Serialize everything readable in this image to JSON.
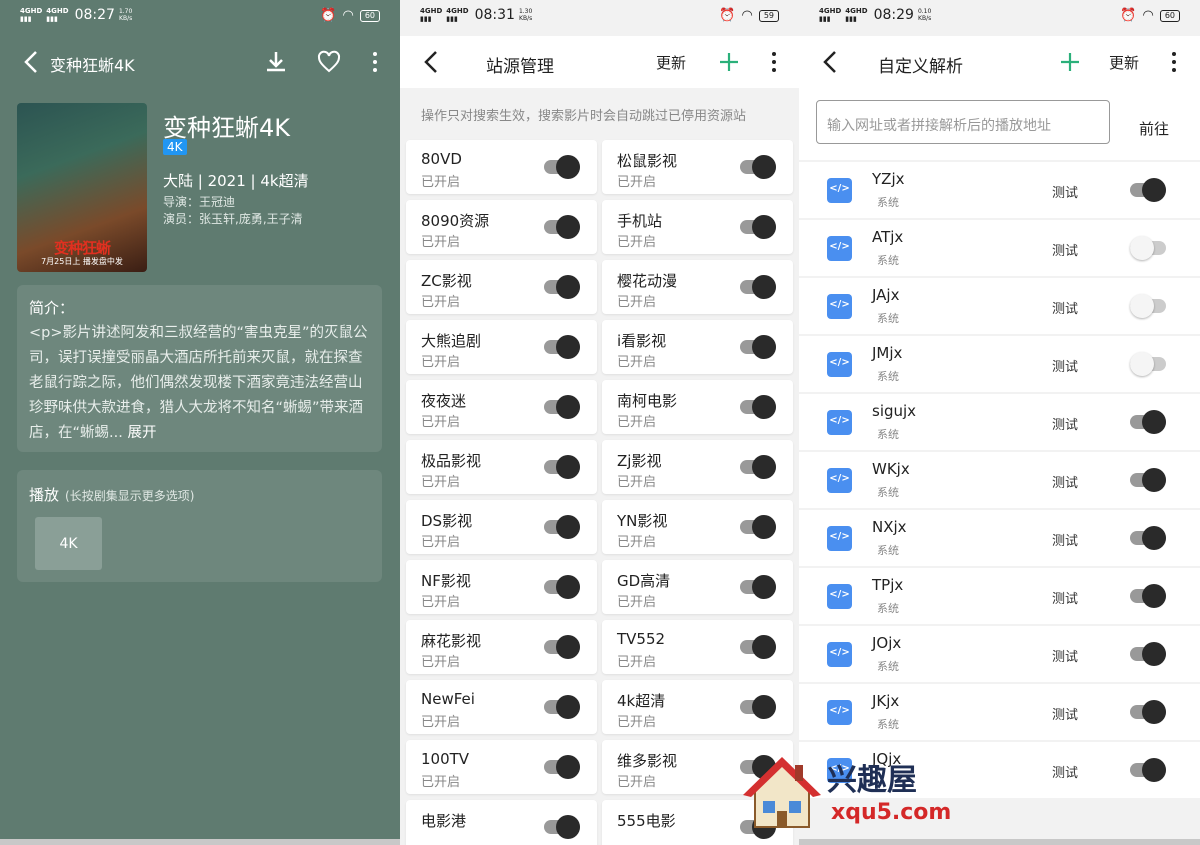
{
  "panel1": {
    "status": {
      "net1": "4GHD",
      "net2": "4GHD",
      "time": "08:27",
      "speed_value": "1.70",
      "speed_unit": "KB/s",
      "battery": "60"
    },
    "header_title": "变种狂蜥4K",
    "poster_title": "变种狂蜥",
    "poster_date": "7月25日上 播发盘中发",
    "movie_title": "变种狂蜥4K",
    "quality_tag": "4K",
    "meta_line": "大陆 | 2021 | 4k超清",
    "director": "导演：王冠迪",
    "actors": "演员：张玉轩,庞勇,王子清",
    "intro_heading": "简介：",
    "intro_text": "<p>影片讲述阿发和三叔经营的“害虫克星”的灭鼠公司，误打误撞受丽晶大酒店所托前来灭鼠，就在探查老鼠行踪之际，他们偶然发现楼下酒家竟违法经营山珍野味供大款进食，猎人大龙将不知名“蜥蜴”带来酒店，在“蜥蜴...",
    "expand_label": "展开",
    "play_heading": "播放",
    "play_hint": "(长按剧集显示更多选项)",
    "episodes": [
      "4K"
    ]
  },
  "panel2": {
    "status": {
      "net1": "4GHD",
      "net2": "4GHD",
      "time": "08:31",
      "speed_value": "1.30",
      "speed_unit": "KB/s",
      "battery": "59"
    },
    "header_title": "站源管理",
    "update_label": "更新",
    "hint": "操作只对搜索生效，搜索影片时会自动跳过已停用资源站",
    "sources": [
      {
        "name": "80VD",
        "status": "已开启",
        "on": true
      },
      {
        "name": "松鼠影视",
        "status": "已开启",
        "on": true
      },
      {
        "name": "8090资源",
        "status": "已开启",
        "on": true
      },
      {
        "name": "手机站",
        "status": "已开启",
        "on": true
      },
      {
        "name": "ZC影视",
        "status": "已开启",
        "on": true
      },
      {
        "name": "樱花动漫",
        "status": "已开启",
        "on": true
      },
      {
        "name": "大熊追剧",
        "status": "已开启",
        "on": true
      },
      {
        "name": "i看影视",
        "status": "已开启",
        "on": true
      },
      {
        "name": "夜夜迷",
        "status": "已开启",
        "on": true
      },
      {
        "name": "南柯电影",
        "status": "已开启",
        "on": true
      },
      {
        "name": "极品影视",
        "status": "已开启",
        "on": true
      },
      {
        "name": "Zj影视",
        "status": "已开启",
        "on": true
      },
      {
        "name": "DS影视",
        "status": "已开启",
        "on": true
      },
      {
        "name": "YN影视",
        "status": "已开启",
        "on": true
      },
      {
        "name": "NF影视",
        "status": "已开启",
        "on": true
      },
      {
        "name": "GD高清",
        "status": "已开启",
        "on": true
      },
      {
        "name": "麻花影视",
        "status": "已开启",
        "on": true
      },
      {
        "name": "TV552",
        "status": "已开启",
        "on": true
      },
      {
        "name": "NewFei",
        "status": "已开启",
        "on": true
      },
      {
        "name": "4k超清",
        "status": "已开启",
        "on": true
      },
      {
        "name": "100TV",
        "status": "已开启",
        "on": true
      },
      {
        "name": "维多影视",
        "status": "已开启",
        "on": true
      },
      {
        "name": "电影港",
        "status": "",
        "on": true
      },
      {
        "name": "555电影",
        "status": "",
        "on": true
      }
    ]
  },
  "panel3": {
    "status": {
      "net1": "4GHD",
      "net2": "4GHD",
      "time": "08:29",
      "speed_value": "0.10",
      "speed_unit": "KB/s",
      "battery": "60"
    },
    "header_title": "自定义解析",
    "update_label": "更新",
    "url_placeholder": "输入网址或者拼接解析后的播放地址",
    "go_label": "前往",
    "test_label": "测试",
    "parsers": [
      {
        "name": "YZjx",
        "type": "系统",
        "on": true
      },
      {
        "name": "ATjx",
        "type": "系统",
        "on": false
      },
      {
        "name": "JAjx",
        "type": "系统",
        "on": false
      },
      {
        "name": "JMjx",
        "type": "系统",
        "on": false
      },
      {
        "name": "sigujx",
        "type": "系统",
        "on": true
      },
      {
        "name": "WKjx",
        "type": "系统",
        "on": true
      },
      {
        "name": "NXjx",
        "type": "系统",
        "on": true
      },
      {
        "name": "TPjx",
        "type": "系统",
        "on": true
      },
      {
        "name": "JOjx",
        "type": "系统",
        "on": true
      },
      {
        "name": "JKjx",
        "type": "系统",
        "on": true
      },
      {
        "name": "JQjx",
        "type": "",
        "on": true
      }
    ]
  },
  "watermark": {
    "title": "兴趣屋",
    "url": "xqu5.com"
  },
  "colors": {
    "panel1_bg": "#5f7b70",
    "accent_green": "#2bb07a",
    "tag_blue": "#2196f3",
    "toggle_thumb": "#2a2a2a"
  }
}
